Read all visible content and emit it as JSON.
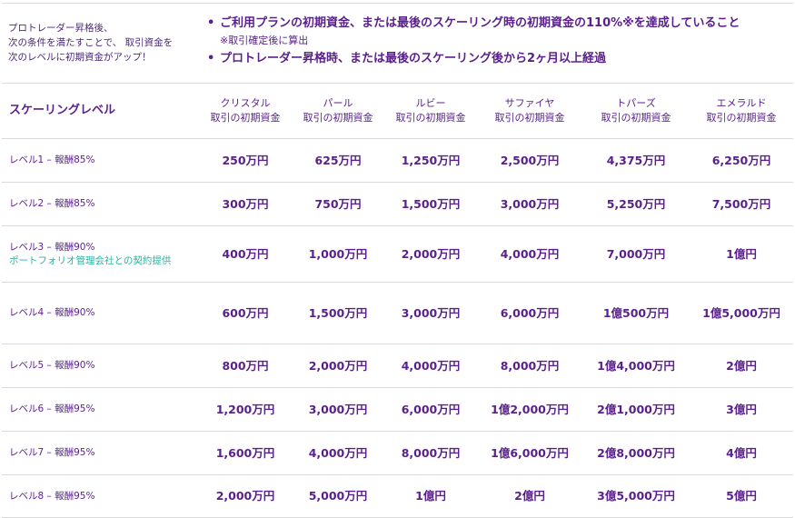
{
  "intro_lines": [
    "プロトレーダー昇格後、",
    "次の条件を満たすことで、 取引資金を",
    "次のレベルに初期資金がアップ！"
  ],
  "conditions": [
    {
      "bullet": "•",
      "text": "ご利用プランの初期資金、または最後のスケーリング時の初期資金の110%※を達成していること",
      "note": "※取引確定後に算出"
    },
    {
      "bullet": "•",
      "text": "プロトレーダー昇格時、または最後のスケーリング後から2ヶ月以上経過",
      "note": ""
    }
  ],
  "table": {
    "corner_label": "スケーリングレベル",
    "columns": [
      {
        "plan": "クリスタル",
        "sub": "取引の初期資金"
      },
      {
        "plan": "パール",
        "sub": "取引の初期資金"
      },
      {
        "plan": "ルビー",
        "sub": "取引の初期資金"
      },
      {
        "plan": "サファイヤ",
        "sub": "取引の初期資金"
      },
      {
        "plan": "トパーズ",
        "sub": "取引の初期資金"
      },
      {
        "plan": "エメラルド",
        "sub": "取引の初期資金"
      }
    ],
    "rows": [
      {
        "level": "レベル1 – 報酬85%",
        "extra": "",
        "values": [
          "250万円",
          "625万円",
          "1,250万円",
          "2,500万円",
          "4,375万円",
          "6,250万円"
        ]
      },
      {
        "level": "レベル2 – 報酬85%",
        "extra": "",
        "values": [
          "300万円",
          "750万円",
          "1,500万円",
          "3,000万円",
          "5,250万円",
          "7,500万円"
        ]
      },
      {
        "level": "レベル3 – 報酬90%",
        "extra": "ポートフォリオ管理会社との契約提供",
        "values": [
          "400万円",
          "1,000万円",
          "2,000万円",
          "4,000万円",
          "7,000万円",
          "1億円"
        ]
      },
      {
        "level": "レベル4 – 報酬90%",
        "extra": "",
        "values": [
          "600万円",
          "1,500万円",
          "3,000万円",
          "6,000万円",
          "1億500万円",
          "1億5,000万円"
        ]
      },
      {
        "level": "レベル5 – 報酬90%",
        "extra": "",
        "values": [
          "800万円",
          "2,000万円",
          "4,000万円",
          "8,000万円",
          "1億4,000万円",
          "2億円"
        ]
      },
      {
        "level": "レベル6 – 報酬95%",
        "extra": "",
        "values": [
          "1,200万円",
          "3,000万円",
          "6,000万円",
          "1億2,000万円",
          "2億1,000万円",
          "3億円"
        ]
      },
      {
        "level": "レベル7 – 報酬95%",
        "extra": "",
        "values": [
          "1,600万円",
          "4,000万円",
          "8,000万円",
          "1億6,000万円",
          "2億8,000万円",
          "4億円"
        ]
      },
      {
        "level": "レベル8 – 報酬95%",
        "extra": "",
        "values": [
          "2,000万円",
          "5,000万円",
          "1億円",
          "2億円",
          "3億5,000万円",
          "5億円"
        ]
      }
    ]
  }
}
